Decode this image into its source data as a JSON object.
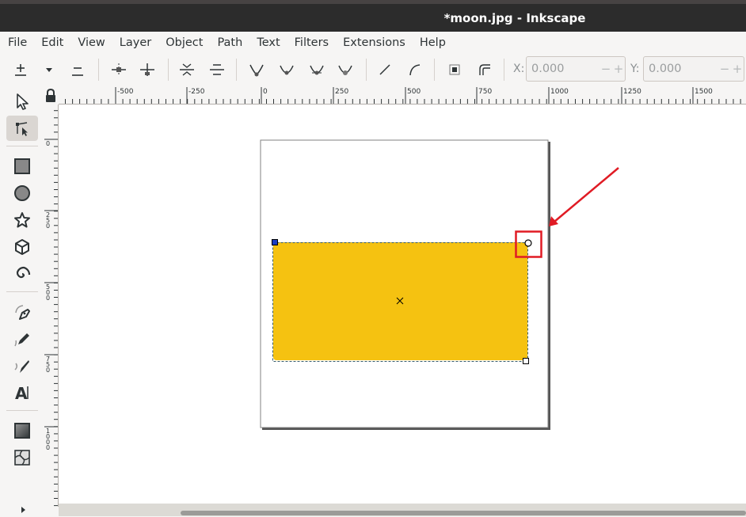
{
  "window": {
    "title": "*moon.jpg - Inkscape"
  },
  "menu": [
    "File",
    "Edit",
    "View",
    "Layer",
    "Object",
    "Path",
    "Text",
    "Filters",
    "Extensions",
    "Help"
  ],
  "toolbar": {
    "x_label": "X:",
    "x_value": "0.000",
    "y_label": "Y:",
    "y_value": "0.000",
    "minus": "−",
    "plus": "+"
  },
  "ruler": {
    "h_labels": [
      "-500",
      "-250",
      "0",
      "250",
      "500",
      "750",
      "1000",
      "1250",
      "1500"
    ],
    "v_labels": [
      "0",
      "250",
      "500",
      "750",
      "1000"
    ]
  },
  "colors": {
    "fill": "#f5c211",
    "selection_handle": "#1a3cc0",
    "annotation": "#e01b24"
  },
  "icons": {
    "tools": [
      "selector-icon",
      "node-editor-icon",
      "rectangle-icon",
      "circle-icon",
      "star-icon",
      "3d-box-icon",
      "spiral-icon",
      "pen-icon",
      "pencil-icon",
      "calligraphy-icon",
      "text-icon",
      "gradient-icon",
      "mesh-icon"
    ]
  }
}
